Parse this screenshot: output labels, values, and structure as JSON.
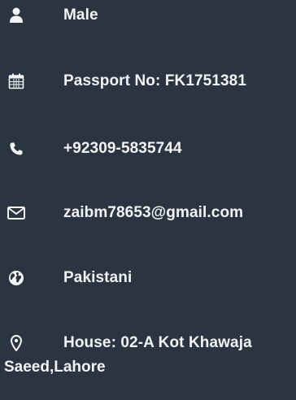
{
  "profile": {
    "items": [
      {
        "icon": "user-icon",
        "text": "Male"
      },
      {
        "icon": "calendar-icon",
        "text": "Passport No: FK1751381"
      },
      {
        "icon": "phone-icon",
        "text": "+92309-5835744"
      },
      {
        "icon": "envelope-icon",
        "text": "zaibm78653@gmail.com"
      },
      {
        "icon": "globe-icon",
        "text": "Pakistani"
      },
      {
        "icon": "map-marker-icon",
        "text": "House: 02-A Kot Khawaja",
        "continuation": "Saeed,Lahore"
      }
    ]
  },
  "colors": {
    "background": "#2b3542",
    "text": "#f1f3f5"
  }
}
